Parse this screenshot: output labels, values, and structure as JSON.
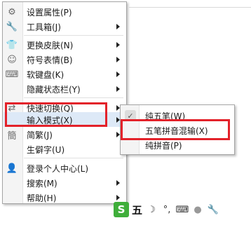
{
  "menu": {
    "items": [
      {
        "label": "设置属性(P)",
        "icon": "gear-icon",
        "arrow": false
      },
      {
        "label": "工具箱(J)",
        "icon": "wrench-icon",
        "arrow": true
      },
      {
        "label": "更换皮肤(N)",
        "icon": "shirt-icon",
        "arrow": true
      },
      {
        "label": "符号表情(B)",
        "icon": "smiley-icon",
        "arrow": true
      },
      {
        "label": "软键盘(K)",
        "icon": "keyboard-icon",
        "arrow": true
      },
      {
        "label": "隐藏状态栏(Y)",
        "icon": "",
        "arrow": true
      },
      {
        "label": "快速切换(Q)",
        "icon": "switch-icon",
        "arrow": true
      },
      {
        "label": "输入模式(X)",
        "icon": "",
        "arrow": true
      },
      {
        "label": "简繁(J)",
        "icon": "simplified-traditional-icon",
        "arrow": true
      },
      {
        "label": "生僻字(U)",
        "icon": "",
        "arrow": false
      },
      {
        "label": "登录个人中心(L)",
        "icon": "user-icon",
        "arrow": false
      },
      {
        "label": "搜索(M)",
        "icon": "",
        "arrow": true
      },
      {
        "label": "帮助(H)",
        "icon": "",
        "arrow": true
      }
    ]
  },
  "submenu": {
    "items": [
      {
        "label": "纯五笔(W)",
        "checked": true
      },
      {
        "label": "五笔拼音混输(X)",
        "checked": false
      },
      {
        "label": "纯拼音(P)",
        "checked": false
      }
    ]
  },
  "toolbar": {
    "logo": "S",
    "mode": "五",
    "icons": [
      "moon-icon",
      "punctuation-icon",
      "keyboard-icon",
      "user-icon",
      "wrench-icon"
    ]
  },
  "colors": {
    "highlight_border": "#e3222a",
    "active_row": "#dde9f7",
    "logo_green": "#3fae3a"
  }
}
